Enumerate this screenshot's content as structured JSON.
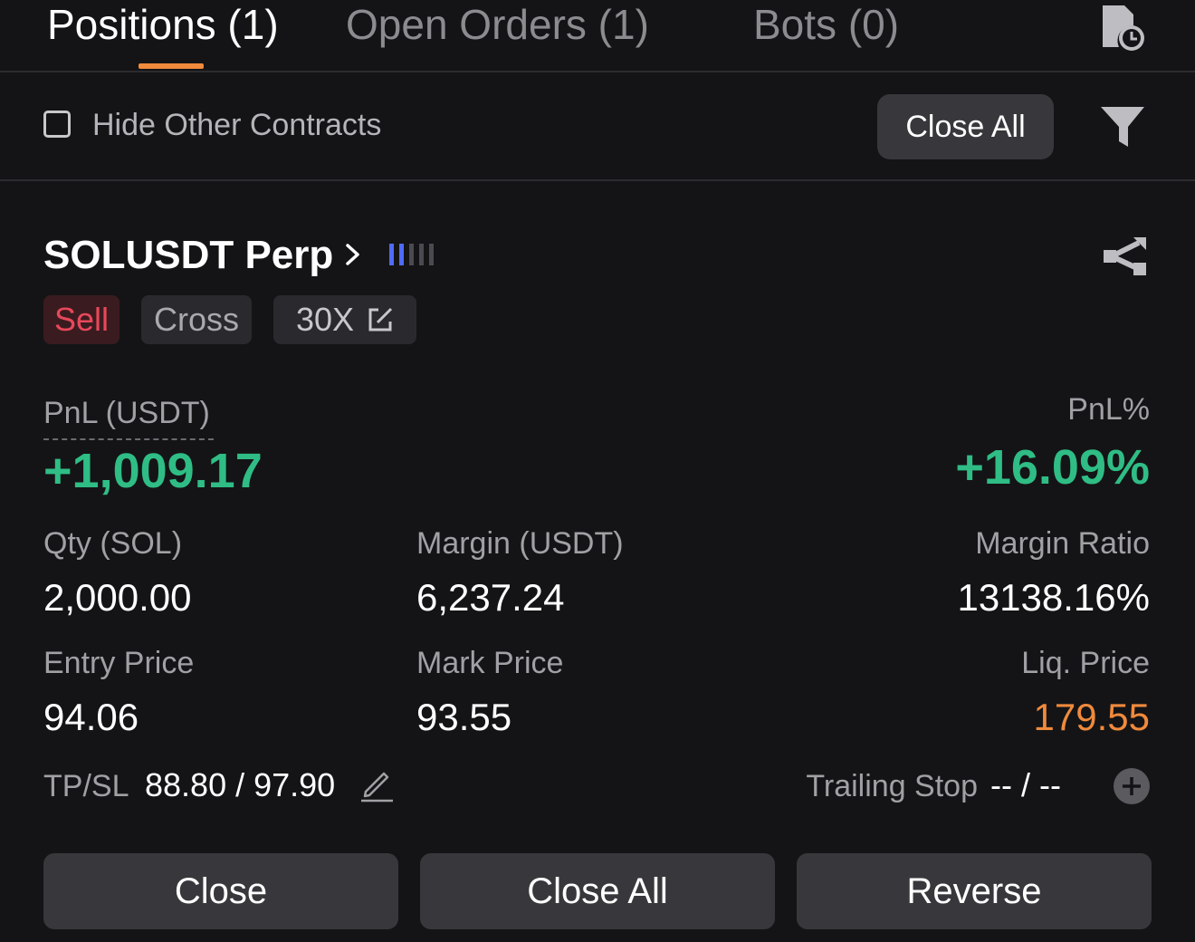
{
  "tabs": [
    {
      "label": "Positions (1)",
      "active": true
    },
    {
      "label": "Open Orders (1)",
      "active": false
    },
    {
      "label": "Bots (0)",
      "active": false
    }
  ],
  "filter": {
    "hide_other_label": "Hide Other Contracts",
    "hide_other_checked": false,
    "close_all_label": "Close All"
  },
  "position": {
    "symbol": "SOLUSDT Perp",
    "adl_level": 2,
    "adl_max": 5,
    "side": "Sell",
    "margin_mode": "Cross",
    "leverage": "30X",
    "pnl_label": "PnL (USDT)",
    "pnl_value": "+1,009.17",
    "pnl_pct_label": "PnL%",
    "pnl_pct_value": "+16.09%",
    "qty_label": "Qty (SOL)",
    "qty_value": "2,000.00",
    "margin_label": "Margin (USDT)",
    "margin_value": "6,237.24",
    "margin_ratio_label": "Margin Ratio",
    "margin_ratio_value": "13138.16%",
    "entry_label": "Entry Price",
    "entry_value": "94.06",
    "mark_label": "Mark Price",
    "mark_value": "93.55",
    "liq_label": "Liq. Price",
    "liq_value": "179.55",
    "tpsl_label": "TP/SL",
    "tpsl_value": "88.80 / 97.90",
    "trailing_label": "Trailing Stop",
    "trailing_value": "-- / --"
  },
  "actions": {
    "close_label": "Close",
    "close_all_label": "Close All",
    "reverse_label": "Reverse"
  },
  "colors": {
    "accent": "#f08a3c",
    "profit": "#2fbd85",
    "sell": "#e8485a",
    "adl_active": "#4f6bff"
  },
  "icons": [
    "history-icon",
    "filter-icon",
    "chevron-right-icon",
    "adl-indicator-icon",
    "share-icon",
    "edit-icon",
    "pencil-icon",
    "plus-circle-icon"
  ]
}
